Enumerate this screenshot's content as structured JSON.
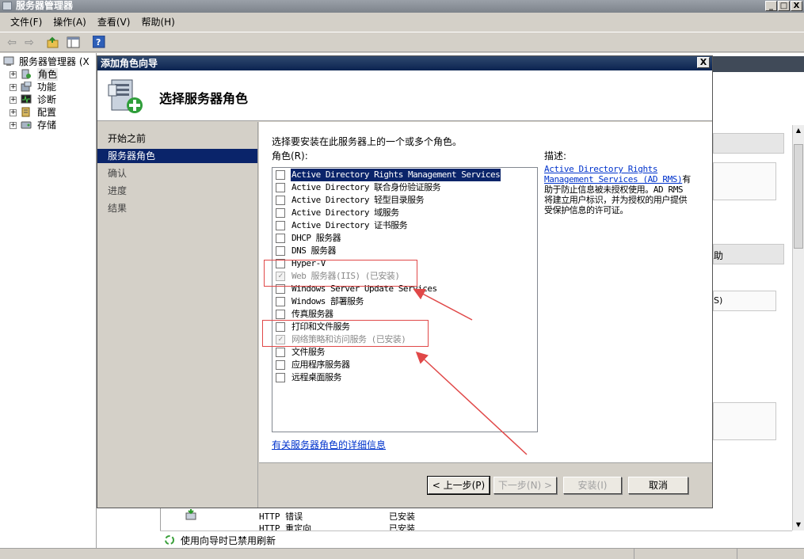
{
  "main_window": {
    "title": "服务器管理器",
    "controls": {
      "minimize": "_",
      "maximize": "□",
      "close": "X"
    },
    "menu": [
      "文件(F)",
      "操作(A)",
      "查看(V)",
      "帮助(H)"
    ]
  },
  "tree": {
    "root": "服务器管理器 (X",
    "items": [
      "角色",
      "功能",
      "诊断",
      "配置",
      "存储"
    ]
  },
  "background": {
    "help_text": "助",
    "paren_text": "S)",
    "list_rows": [
      {
        "name": "HTTP 错误",
        "status": "已安装"
      },
      {
        "name": "HTTP 重定向",
        "status": "已安装"
      }
    ],
    "status_text": "使用向导时已禁用刷新"
  },
  "wizard": {
    "title": "添加角色向导",
    "close": "X",
    "heading": "选择服务器角色",
    "nav": [
      "开始之前",
      "服务器角色",
      "确认",
      "进度",
      "结果"
    ],
    "nav_active_index": 1,
    "instruction": "选择要安装在此服务器上的一个或多个角色。",
    "roles_label": "角色(R):",
    "roles": [
      {
        "label": "Active Directory Rights Management Services",
        "checked": false,
        "disabled": false
      },
      {
        "label": "Active Directory 联合身份验证服务",
        "checked": false,
        "disabled": false
      },
      {
        "label": "Active Directory 轻型目录服务",
        "checked": false,
        "disabled": false
      },
      {
        "label": "Active Directory 域服务",
        "checked": false,
        "disabled": false
      },
      {
        "label": "Active Directory 证书服务",
        "checked": false,
        "disabled": false
      },
      {
        "label": "DHCP 服务器",
        "checked": false,
        "disabled": false
      },
      {
        "label": "DNS 服务器",
        "checked": false,
        "disabled": false
      },
      {
        "label": "Hyper-V",
        "checked": false,
        "disabled": false
      },
      {
        "label": "Web 服务器(IIS)  (已安装)",
        "checked": true,
        "disabled": true
      },
      {
        "label": "Windows Server Update Services",
        "checked": false,
        "disabled": false
      },
      {
        "label": "Windows 部署服务",
        "checked": false,
        "disabled": false
      },
      {
        "label": "传真服务器",
        "checked": false,
        "disabled": false
      },
      {
        "label": "打印和文件服务",
        "checked": false,
        "disabled": false
      },
      {
        "label": "网络策略和访问服务  (已安装)",
        "checked": true,
        "disabled": true
      },
      {
        "label": "文件服务",
        "checked": false,
        "disabled": false
      },
      {
        "label": "应用程序服务器",
        "checked": false,
        "disabled": false
      },
      {
        "label": "远程桌面服务",
        "checked": false,
        "disabled": false
      }
    ],
    "description_label": "描述:",
    "description_link": "Active Directory Rights Management Services (AD RMS)",
    "description_text": "有助于防止信息被未授权使用。AD RMS 将建立用户标识，并为授权的用户提供受保护信息的许可证。",
    "more_info_link": "有关服务器角色的详细信息",
    "buttons": {
      "back": "< 上一步(P)",
      "next": "下一步(N) >",
      "install": "安装(I)",
      "cancel": "取消"
    }
  }
}
